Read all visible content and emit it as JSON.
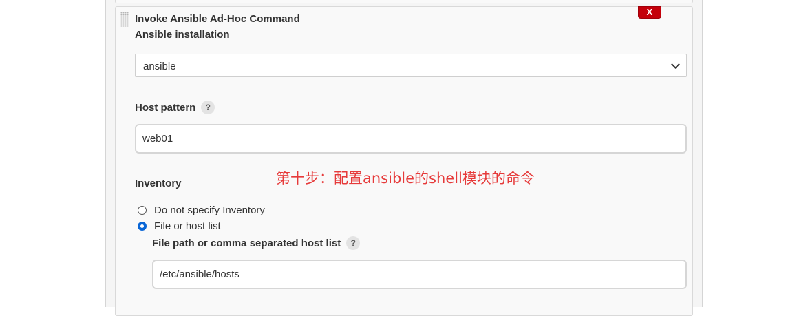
{
  "step": {
    "title": "Invoke Ansible Ad-Hoc Command",
    "delete_label": "X"
  },
  "ansible_installation": {
    "label": "Ansible installation",
    "selected": "ansible"
  },
  "host_pattern": {
    "label": "Host pattern",
    "help": "?",
    "value": "web01"
  },
  "annotation": "第十步：配置ansible的shell模块的命令",
  "inventory": {
    "label": "Inventory",
    "options": [
      {
        "label": "Do not specify Inventory",
        "checked": false
      },
      {
        "label": "File or host list",
        "checked": true
      }
    ],
    "file_path": {
      "label": "File path or comma separated host list",
      "help": "?",
      "value": "/etc/ansible/hosts"
    }
  },
  "colors": {
    "delete_button": "#c4000a",
    "annotation": "#e63a3a",
    "radio_checked": "#0a66d6"
  }
}
